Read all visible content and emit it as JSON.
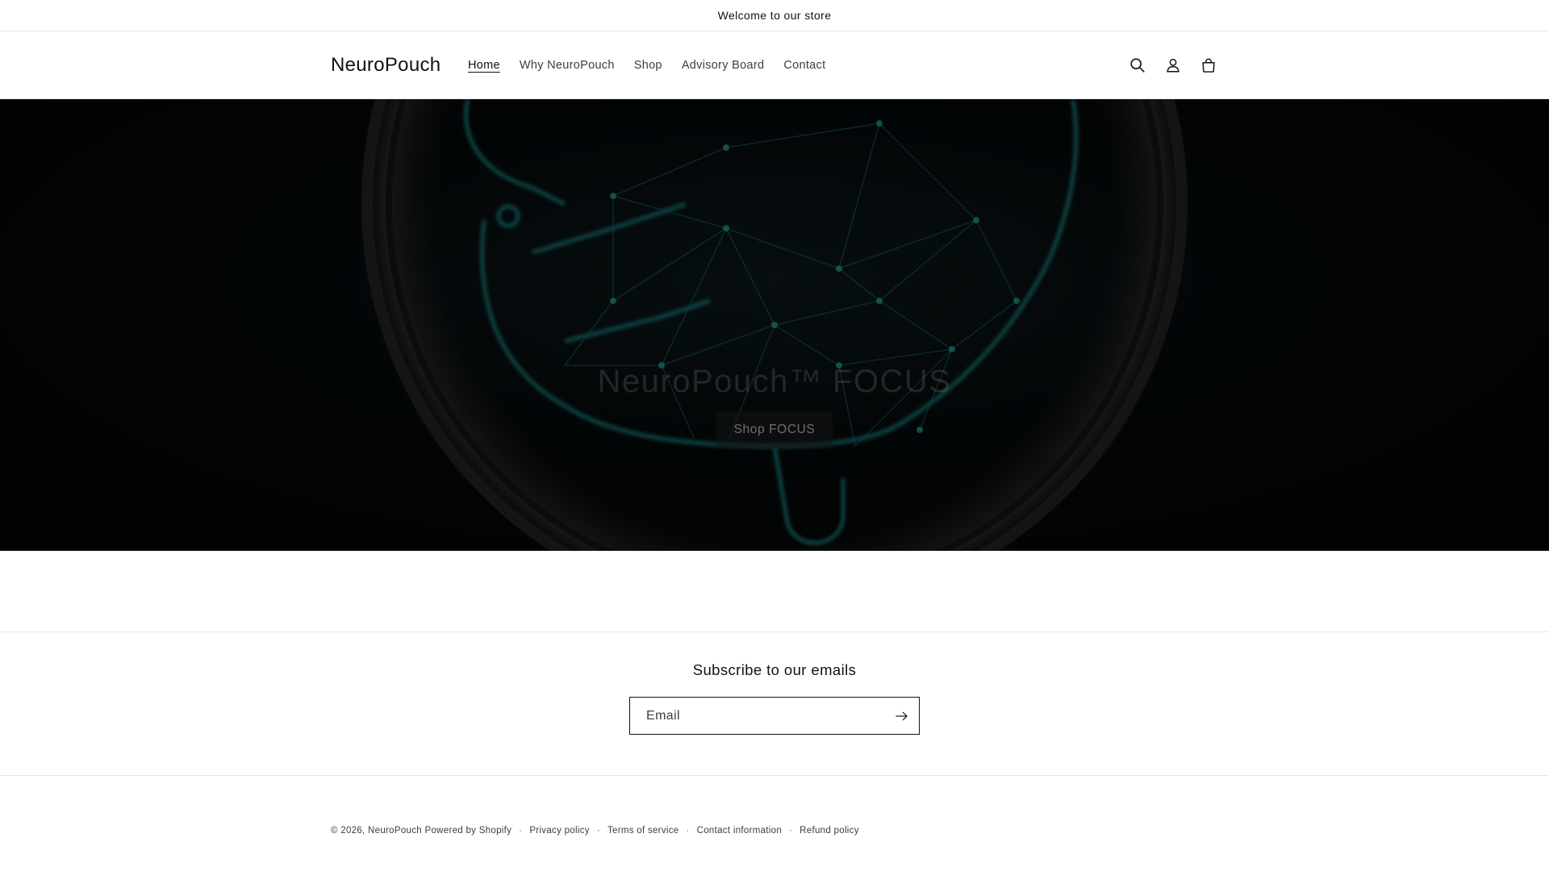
{
  "announcement": {
    "text": "Welcome to our store"
  },
  "header": {
    "logo": "NeuroPouch",
    "nav": [
      {
        "label": "Home",
        "active": true
      },
      {
        "label": "Why NeuroPouch",
        "active": false
      },
      {
        "label": "Shop",
        "active": false
      },
      {
        "label": "Advisory Board",
        "active": false
      },
      {
        "label": "Contact",
        "active": false
      }
    ],
    "icons": [
      "search-icon",
      "account-icon",
      "cart-icon"
    ]
  },
  "hero": {
    "title": "NeuroPouch™ FOCUS",
    "button_label": "Shop FOCUS",
    "accent_color": "#1f8a8a"
  },
  "newsletter": {
    "title": "Subscribe to our emails",
    "email_placeholder": "Email"
  },
  "footer": {
    "copyright": "© 2026,",
    "brand_link": "NeuroPouch",
    "powered": "Powered by Shopify",
    "policies": [
      "Privacy policy",
      "Terms of service",
      "Contact information",
      "Refund policy"
    ]
  }
}
